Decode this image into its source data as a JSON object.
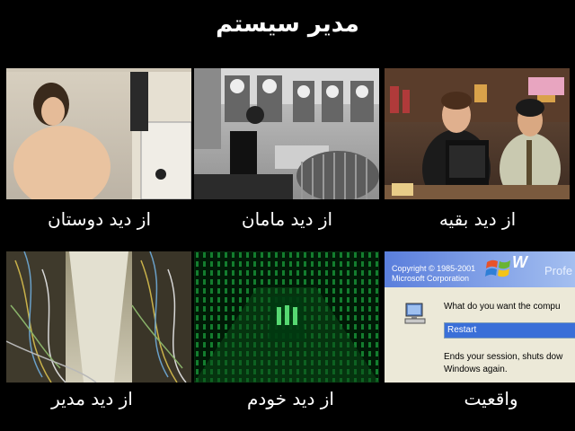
{
  "title": "مدیر سیستم",
  "panels": [
    {
      "caption": "از دید دوستان",
      "image": "nerd-at-computer-photo"
    },
    {
      "caption": "از دید مامان",
      "image": "mainframe-operator-photo"
    },
    {
      "caption": "از دید بقیه",
      "image": "it-crowd-office-photo"
    },
    {
      "caption": "از دید مدیر",
      "image": "messy-server-room-photo"
    },
    {
      "caption": "از دید خودم",
      "image": "matrix-code-corridor-photo"
    },
    {
      "caption": "واقعیت",
      "image": "windows-shutdown-dialog"
    }
  ],
  "windows_dialog": {
    "copyright_line1": "Copyright © 1985-2001",
    "copyright_line2": "Microsoft Corporation",
    "logo_partial": "W",
    "brand_partial": "Profe",
    "question": "What do you want the compu",
    "selected_option": "Restart",
    "description_line1": "Ends your session, shuts dow",
    "description_line2": "Windows again."
  }
}
